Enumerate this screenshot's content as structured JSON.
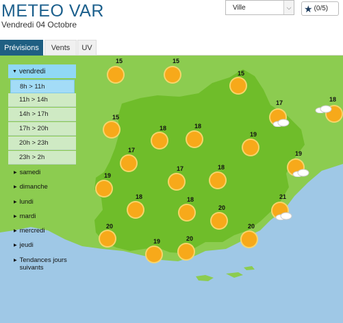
{
  "header": {
    "title": "METEO VAR",
    "date": "Vendredi 04 Octobre",
    "city_select": {
      "value": "Ville"
    },
    "favorites": {
      "label": "(0/5)",
      "icon": "star-icon"
    }
  },
  "tabs": [
    {
      "label": "Prévisions",
      "active": true
    },
    {
      "label": "Vents",
      "active": false
    },
    {
      "label": "UV",
      "active": false
    }
  ],
  "sidebar": {
    "current_day": "vendredi",
    "slots": [
      "8h > 11h",
      "11h > 14h",
      "14h > 17h",
      "17h > 20h",
      "20h > 23h",
      "23h > 2h"
    ],
    "active_slot": "8h > 11h",
    "days": [
      "samedi",
      "dimanche",
      "lundi",
      "mardi",
      "mercredi",
      "jeudi",
      "Tendances jours suivants"
    ]
  },
  "map": {
    "colors": {
      "sea": "#9fc8e6",
      "land": "#8ccc50",
      "department": "#6fbd2a"
    },
    "points": [
      {
        "temp": "15",
        "icon": "sun"
      },
      {
        "temp": "15",
        "icon": "sun"
      },
      {
        "temp": "15",
        "icon": "sun"
      },
      {
        "temp": "17",
        "icon": "sun-cloud"
      },
      {
        "temp": "18",
        "icon": "sun-cloud"
      },
      {
        "temp": "15",
        "icon": "sun"
      },
      {
        "temp": "18",
        "icon": "sun"
      },
      {
        "temp": "18",
        "icon": "sun"
      },
      {
        "temp": "19",
        "icon": "sun"
      },
      {
        "temp": "17",
        "icon": "sun"
      },
      {
        "temp": "19",
        "icon": "sun-cloud"
      },
      {
        "temp": "17",
        "icon": "sun"
      },
      {
        "temp": "18",
        "icon": "sun"
      },
      {
        "temp": "19",
        "icon": "sun"
      },
      {
        "temp": "18",
        "icon": "sun"
      },
      {
        "temp": "18",
        "icon": "sun"
      },
      {
        "temp": "21",
        "icon": "sun-cloud"
      },
      {
        "temp": "20",
        "icon": "sun"
      },
      {
        "temp": "20",
        "icon": "sun"
      },
      {
        "temp": "20",
        "icon": "sun"
      },
      {
        "temp": "20",
        "icon": "sun"
      },
      {
        "temp": "19",
        "icon": "sun"
      },
      {
        "temp": "20",
        "icon": "sun"
      }
    ]
  }
}
